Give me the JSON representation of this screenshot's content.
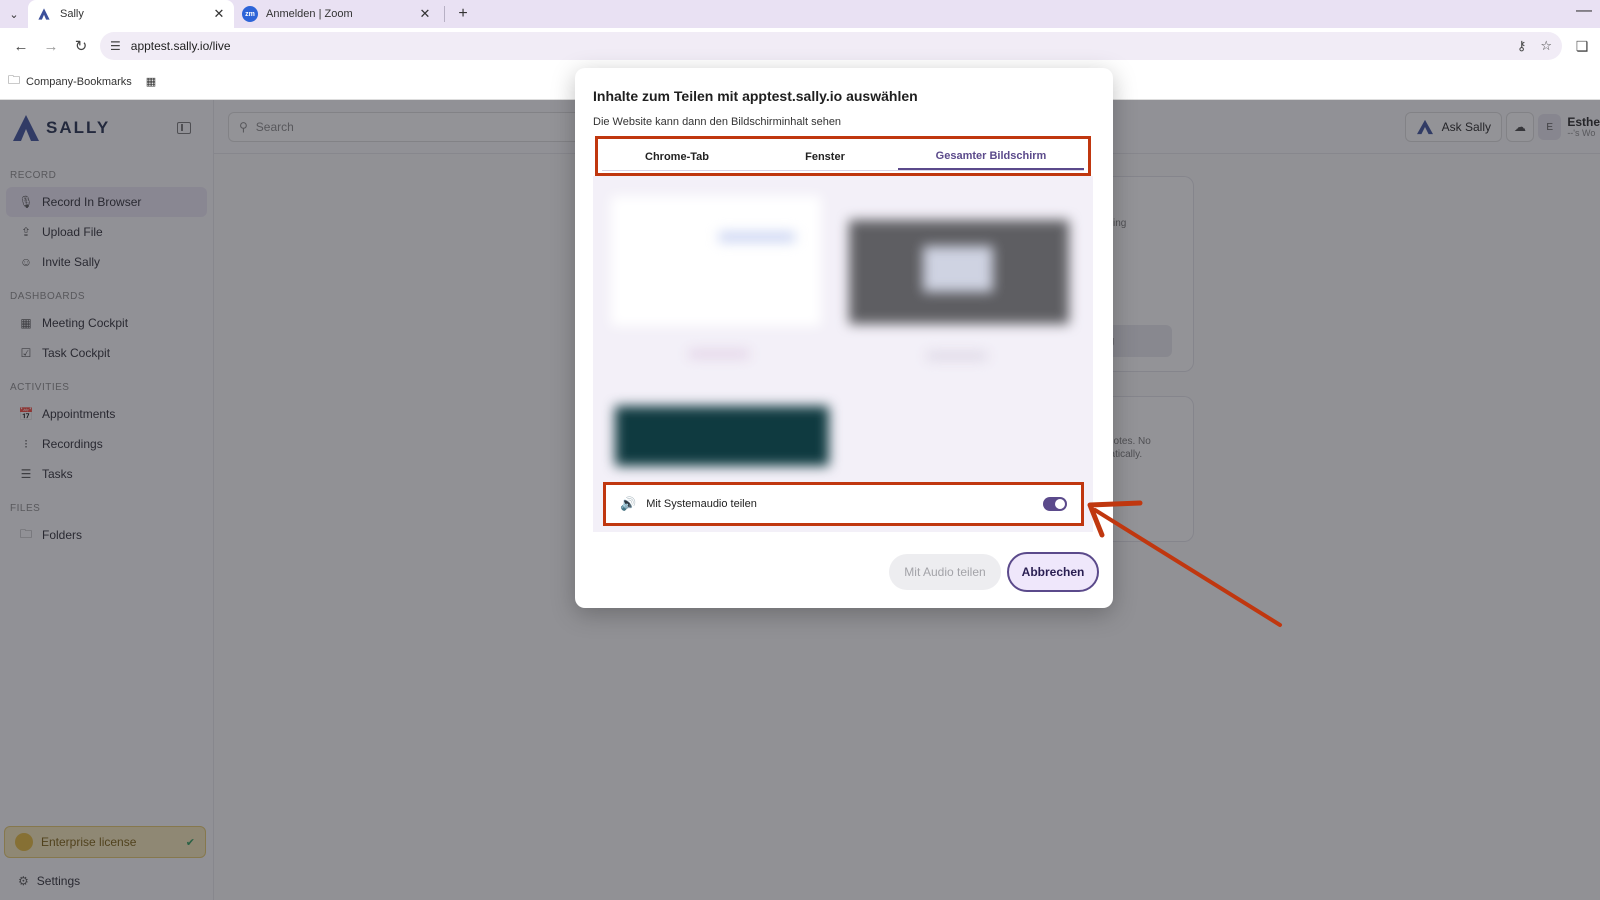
{
  "browser": {
    "tabs": [
      {
        "title": "Sally",
        "active": true
      },
      {
        "title": "Anmelden | Zoom",
        "active": false,
        "favicon_text": "zm"
      }
    ],
    "url": "apptest.sally.io/live",
    "bookmarks": [
      {
        "label": "Company-Bookmarks"
      }
    ]
  },
  "app": {
    "logo_text": "SALLY",
    "search_placeholder": "Search",
    "ask_sally_label": "Ask Sally",
    "user": {
      "initial": "E",
      "name": "Esthe",
      "sub": "--'s Wo"
    },
    "sidebar": {
      "sections": [
        {
          "label": "RECORD",
          "items": [
            {
              "label": "Record In Browser",
              "icon": "mic-icon",
              "active": true
            },
            {
              "label": "Upload File",
              "icon": "upload-icon"
            },
            {
              "label": "Invite Sally",
              "icon": "user-plus-icon"
            }
          ]
        },
        {
          "label": "DASHBOARDS",
          "items": [
            {
              "label": "Meeting Cockpit",
              "icon": "grid-icon"
            },
            {
              "label": "Task Cockpit",
              "icon": "checkbox-icon"
            }
          ]
        },
        {
          "label": "ACTIVITIES",
          "items": [
            {
              "label": "Appointments",
              "icon": "calendar-icon"
            },
            {
              "label": "Recordings",
              "icon": "waveform-icon"
            },
            {
              "label": "Tasks",
              "icon": "list-icon"
            }
          ]
        },
        {
          "label": "FILES",
          "items": [
            {
              "label": "Folders",
              "icon": "folder-icon"
            }
          ]
        }
      ],
      "license_label": "Enterprise license",
      "settings_label": "Settings"
    },
    "background_fragments": [
      "ing",
      "g",
      "notes. No",
      "natically."
    ]
  },
  "dialog": {
    "title": "Inhalte zum Teilen mit apptest.sally.io auswählen",
    "subtitle": "Die Website kann dann den Bildschirminhalt sehen",
    "tabs": [
      {
        "label": "Chrome-Tab",
        "selected": false
      },
      {
        "label": "Fenster",
        "selected": false
      },
      {
        "label": "Gesamter Bildschirm",
        "selected": true
      }
    ],
    "audio_label": "Mit Systemaudio teilen",
    "audio_enabled": true,
    "share_button": "Mit Audio teilen",
    "cancel_button": "Abbrechen"
  },
  "colors": {
    "highlight": "#c0370f",
    "accent": "#5b4a8b"
  }
}
